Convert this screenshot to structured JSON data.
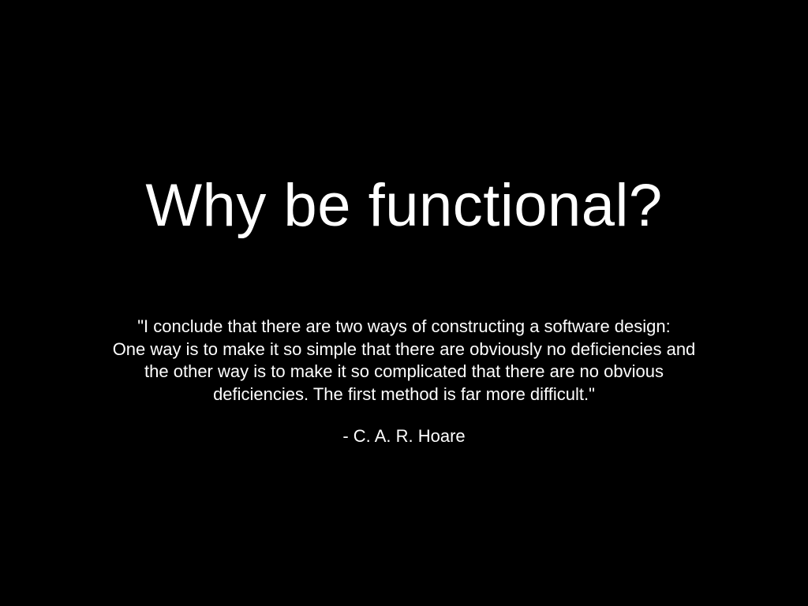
{
  "slide": {
    "title": "Why be functional?",
    "quote_lines": [
      "\"I conclude that there are two ways of constructing a software design:",
      "One way is to make it so simple that there are obviously no deficiencies and",
      "the other way is to make it so complicated that there are no obvious",
      "deficiencies. The first method is far more difficult.\""
    ],
    "attribution": "- C. A. R. Hoare",
    "colors": {
      "background": "#000000",
      "text": "#ffffff"
    }
  }
}
